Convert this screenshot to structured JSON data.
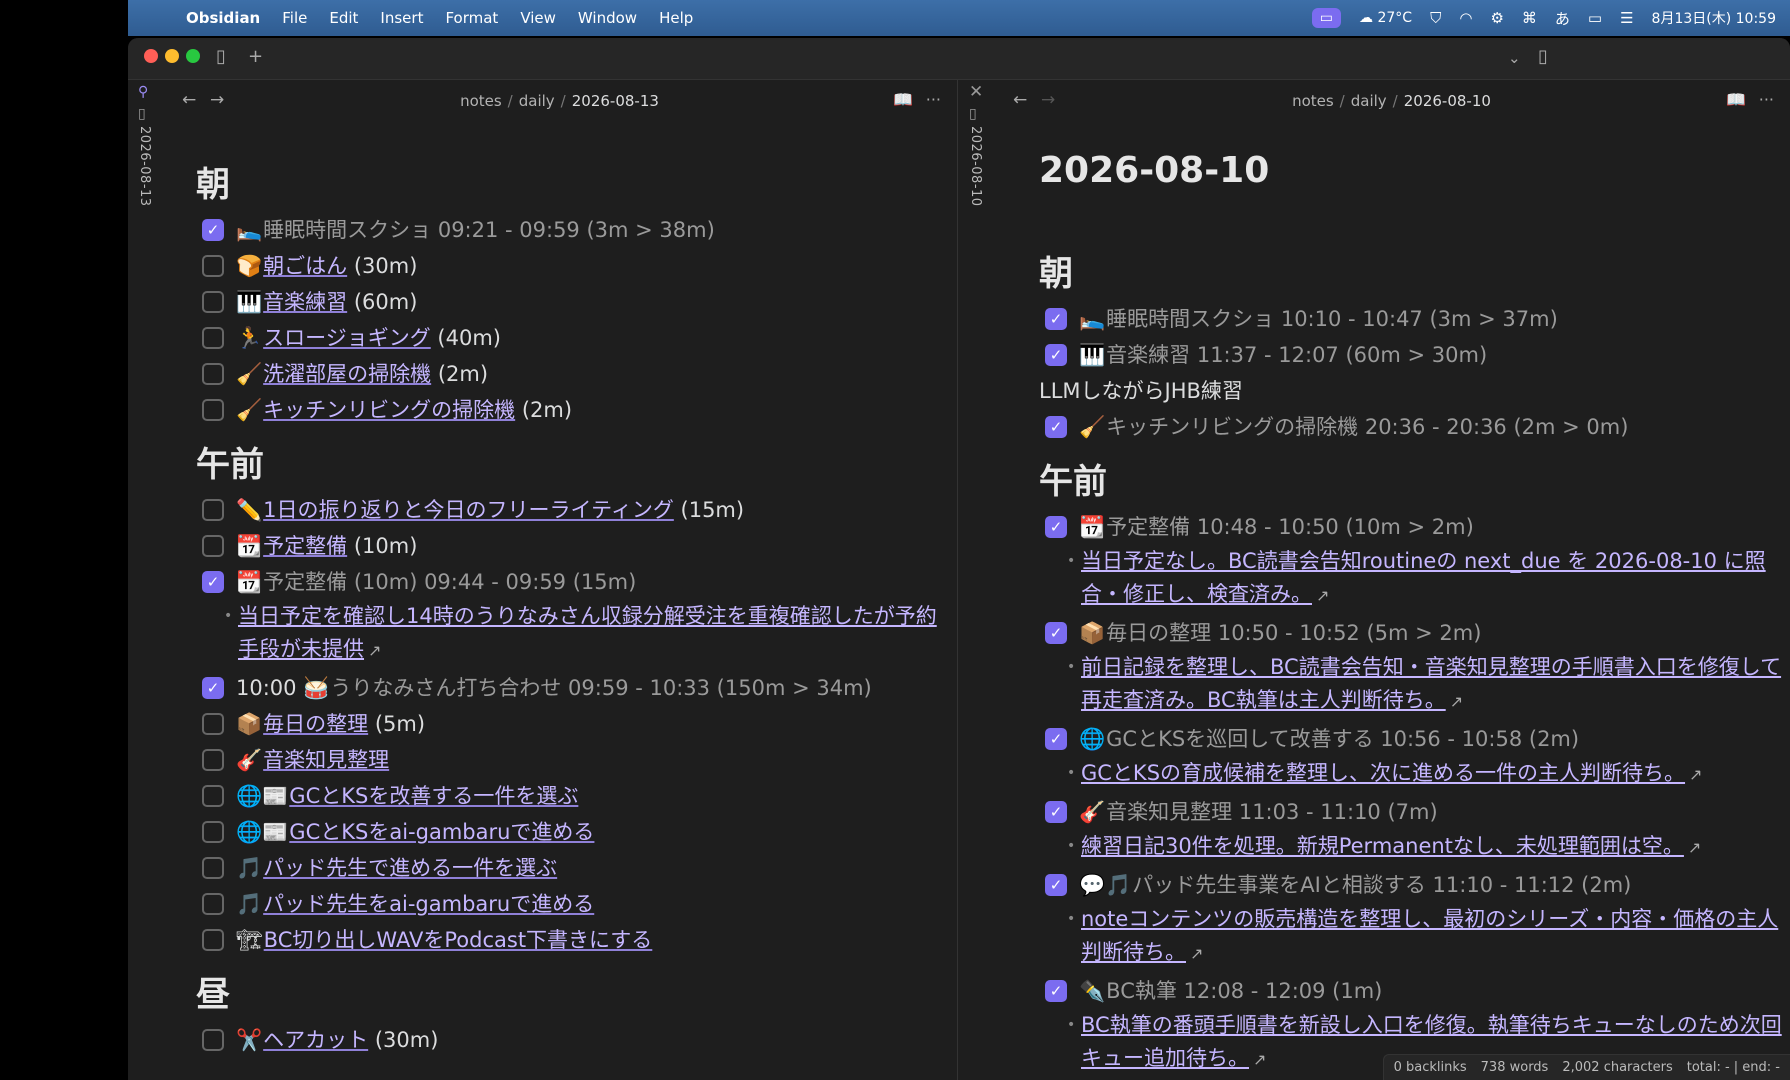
{
  "menubar": {
    "app": "Obsidian",
    "menus": [
      "File",
      "Edit",
      "Insert",
      "Format",
      "View",
      "Window",
      "Help"
    ],
    "weather": "27°C",
    "ime": "あ",
    "datetime": "8月13日(木) 10:59"
  },
  "left": {
    "vertical_title": "2026-08-13",
    "breadcrumb": [
      "notes",
      "daily",
      "2026-08-13"
    ],
    "sections": [
      {
        "heading": "朝",
        "items": [
          {
            "checked": true,
            "emoji": "🛌",
            "link": "睡眠時間スクショ",
            "rest": " 09:21 - 09:59 (3m > 38m)"
          },
          {
            "checked": false,
            "emoji": "🍞",
            "link": "朝ごはん",
            "rest": " (30m)"
          },
          {
            "checked": false,
            "emoji": "🎹",
            "link": "音楽練習",
            "rest": " (60m)"
          },
          {
            "checked": false,
            "emoji": "🏃",
            "link": "スロージョギング",
            "rest": " (40m)"
          },
          {
            "checked": false,
            "emoji": "🧹",
            "link": "洗濯部屋の掃除機",
            "rest": " (2m)"
          },
          {
            "checked": false,
            "emoji": "🧹",
            "link": "キッチンリビングの掃除機",
            "rest": " (2m)"
          }
        ]
      },
      {
        "heading": "午前",
        "items": [
          {
            "checked": false,
            "emoji": "✏️",
            "link": "1日の振り返りと今日のフリーライティング",
            "rest": " (15m)"
          },
          {
            "checked": false,
            "emoji": "📆",
            "link": "予定整備",
            "rest": " (10m)"
          },
          {
            "checked": true,
            "emoji": "📆",
            "link": "予定整備",
            "rest": " (10m) 09:44 - 09:59 (15m)",
            "sub": "当日予定を確認し14時のうりなみさん収録分解受注を重複確認したが予約手段が未提供"
          },
          {
            "checked": true,
            "emoji": "",
            "prefix": "10:00 ",
            "emoji2": "🥁",
            "link": "うりなみさん打ち合わせ",
            "rest": " 09:59 - 10:33 (150m > 34m)"
          },
          {
            "checked": false,
            "emoji": "📦",
            "link": "毎日の整理",
            "rest": " (5m)"
          },
          {
            "checked": false,
            "emoji": "🎸",
            "link": "音楽知見整理",
            "rest": ""
          },
          {
            "checked": false,
            "emoji": "🌐📰",
            "link": "GCとKSを改善する一件を選ぶ",
            "rest": ""
          },
          {
            "checked": false,
            "emoji": "🌐📰",
            "link": "GCとKSをai-gambaruで進める",
            "rest": ""
          },
          {
            "checked": false,
            "emoji": "🎵",
            "link": "パッド先生で進める一件を選ぶ",
            "rest": ""
          },
          {
            "checked": false,
            "emoji": "🎵",
            "link": "パッド先生をai-gambaruで進める",
            "rest": ""
          },
          {
            "checked": false,
            "emoji": "🏗",
            "link": "BC切り出しWAVをPodcast下書きにする",
            "rest": ""
          }
        ]
      },
      {
        "heading": "昼",
        "items": [
          {
            "checked": false,
            "emoji": "✂️",
            "link": "ヘアカット",
            "rest": " (30m)"
          }
        ]
      }
    ]
  },
  "right": {
    "vertical_title": "2026-08-10",
    "breadcrumb": [
      "notes",
      "daily",
      "2026-08-10"
    ],
    "title": "2026-08-10",
    "sections": [
      {
        "heading": "朝",
        "items": [
          {
            "checked": true,
            "emoji": "🛌",
            "link": "睡眠時間スクショ",
            "rest": " 10:10 - 10:47 (3m > 37m)"
          },
          {
            "checked": true,
            "emoji": "🎹",
            "link": "音楽練習",
            "rest": " 11:37 - 12:07 (60m > 30m)"
          },
          {
            "para": "LLMしながらJHB練習"
          },
          {
            "checked": true,
            "emoji": "🧹",
            "link": "キッチンリビングの掃除機",
            "rest": " 20:36 - 20:36 (2m > 0m)"
          }
        ]
      },
      {
        "heading": "午前",
        "items": [
          {
            "checked": true,
            "emoji": "📆",
            "link": "予定整備",
            "rest": " 10:48 - 10:50 (10m > 2m)",
            "sub": "当日予定なし。BC読書会告知routineの next_due を 2026-08-10 に照合・修正し、検査済み。"
          },
          {
            "checked": true,
            "emoji": "📦",
            "link": "毎日の整理",
            "rest": " 10:50 - 10:52 (5m > 2m)",
            "sub": "前日記録を整理し、BC読書会告知・音楽知見整理の手順書入口を修復して再走査済み。BC執筆は主人判断待ち。"
          },
          {
            "checked": true,
            "emoji": "🌐",
            "link": "GCとKSを巡回して改善する",
            "rest": " 10:56 - 10:58 (2m)",
            "sub": "GCとKSの育成候補を整理し、次に進める一件の主人判断待ち。"
          },
          {
            "checked": true,
            "emoji": "🎸",
            "link": "音楽知見整理",
            "rest": " 11:03 - 11:10 (7m)",
            "sub": "練習日記30件を処理。新規Permanentなし、未処理範囲は空。"
          },
          {
            "checked": true,
            "emoji": "💬🎵",
            "link": "パッド先生事業をAIと相談する",
            "rest": " 11:10 - 11:12 (2m)",
            "sub": "noteコンテンツの販売構造を整理し、最初のシリーズ・内容・価格の主人判断待ち。"
          },
          {
            "checked": true,
            "emoji": "✒️",
            "link": "BC執筆",
            "rest": " 12:08 - 12:09 (1m)",
            "sub": "BC執筆の番頭手順書を新設し入口を修復。執筆待ちキューなしのため次回キュー追加待ち。"
          }
        ]
      }
    ]
  },
  "status": {
    "backlinks": "0 backlinks",
    "words": "738 words",
    "chars": "2,002 characters",
    "cursor": "total: - | end: -"
  }
}
